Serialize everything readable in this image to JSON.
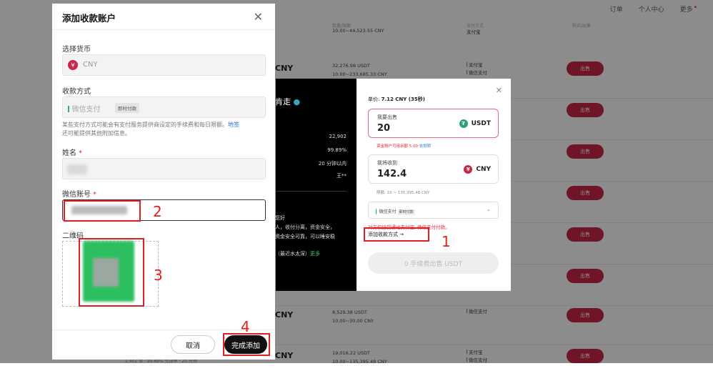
{
  "nav": {
    "orders": "订单",
    "profile": "个人中心",
    "more": "更多"
  },
  "header": {
    "cols": [
      "数量/限额",
      "支付方式",
      "购买/出售"
    ],
    "row0_amt": "10.00~44,523.55 CNY",
    "row0_pay": "支付宝"
  },
  "rows": [
    {
      "pair": "CNY",
      "amount": "32,276.98 USDT",
      "limit": "10.00~233,685.33 CNY",
      "pay": [
        "支付宝",
        "微信支付"
      ],
      "action": "出售"
    },
    {
      "pair": "",
      "amount": "",
      "limit": "",
      "pay": [],
      "action": "出售"
    },
    {
      "pair": "",
      "amount": "",
      "limit": "",
      "pay": [],
      "action": "出售"
    },
    {
      "pair": "",
      "amount": "",
      "limit": "",
      "pay": [],
      "action": "出售"
    },
    {
      "pair": "",
      "amount": "",
      "limit": "",
      "pay": [],
      "action": "出售"
    },
    {
      "pair": "CNY",
      "amount": "8,529.38 USDT",
      "limit": "10.00~30.00 CNY",
      "pay": [
        "微信支付"
      ],
      "action": "出售"
    },
    {
      "pair": "CNY",
      "amount": "19,016.22 USDT",
      "limit": "10.00~135,395.48 CNY",
      "pay": [
        "支付宝",
        "微信支付"
      ],
      "action": "出售"
    }
  ],
  "bottom_text": "2,902 单 · 99.89% 完成率 · 20 分钟",
  "dark": {
    "name": "肯走",
    "stats": [
      "22,902",
      "99.89%",
      "20 分钟以内",
      "王**"
    ],
    "text": [
      "您好",
      "人，收付分离，资金安全，",
      "资金安全可靠，可以睡安稳",
      "（最近水太深）"
    ],
    "more": "更多"
  },
  "trade": {
    "price_label": "单价",
    "price_value": "7.12 CNY (35秒)",
    "sell_label": "我要出售",
    "sell_value": "20",
    "sell_cur": "USDT",
    "avail": "资金账户可用余额 5.00",
    "transfer": "去划转",
    "receive_label": "我将收到",
    "receive_value": "142.4",
    "receive_cur": "CNY",
    "limit": "限额: 10 ~ 135,395.48 CNY",
    "method": "微信支付",
    "method_tag": "即时付款",
    "warn": "对方仅接受通过支付宝, 微信支付付款。",
    "add_method": "添加收款方式 →",
    "submit": "0 手续费出售 USDT"
  },
  "modal": {
    "title": "添加收款账户",
    "currency_label": "选择货币",
    "currency": "CNY",
    "method_label": "收款方式",
    "method": "微信支付",
    "method_tag": "即时付款",
    "hint": "某些支付方式可能会有支付服务提供商设定的手续费和每日限额。",
    "hint_link": "地签",
    "hint2": "还可能提供其他附加信息。",
    "name_label": "姓名",
    "wechat_label": "微信账号",
    "qr_label": "二维码",
    "cancel": "取消",
    "done": "完成添加"
  },
  "annotations": [
    "1",
    "2",
    "3",
    "4"
  ],
  "colors": {
    "sell": "#c8284a",
    "annotation": "#e02020",
    "wechat": "#2dbf5f"
  }
}
